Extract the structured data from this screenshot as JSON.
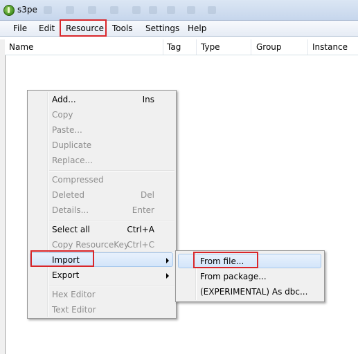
{
  "window": {
    "title": "s3pe"
  },
  "menubar": {
    "items": [
      {
        "label": "File"
      },
      {
        "label": "Edit"
      },
      {
        "label": "Resource"
      },
      {
        "label": "Tools"
      },
      {
        "label": "Settings"
      },
      {
        "label": "Help"
      }
    ],
    "highlighted": "Resource"
  },
  "list": {
    "columns": [
      "Name",
      "Tag",
      "Type",
      "Group",
      "Instance"
    ]
  },
  "context_menu": {
    "items": [
      {
        "label": "Add...",
        "shortcut": "Ins",
        "enabled": true
      },
      {
        "label": "Copy",
        "shortcut": "",
        "enabled": false
      },
      {
        "label": "Paste...",
        "shortcut": "",
        "enabled": false
      },
      {
        "label": "Duplicate",
        "shortcut": "",
        "enabled": false
      },
      {
        "label": "Replace...",
        "shortcut": "",
        "enabled": false
      },
      {
        "label": "Compressed",
        "shortcut": "",
        "enabled": false
      },
      {
        "label": "Deleted",
        "shortcut": "Del",
        "enabled": false
      },
      {
        "label": "Details...",
        "shortcut": "Enter",
        "enabled": false
      },
      {
        "label": "Select all",
        "shortcut": "Ctrl+A",
        "enabled": true
      },
      {
        "label": "Copy ResourceKey",
        "shortcut": "Ctrl+C",
        "enabled": false
      },
      {
        "label": "Import",
        "shortcut": "",
        "enabled": true,
        "submenu": true,
        "hovered": true
      },
      {
        "label": "Export",
        "shortcut": "",
        "enabled": true,
        "submenu": true
      },
      {
        "label": "Hex Editor",
        "shortcut": "",
        "enabled": false
      },
      {
        "label": "Text Editor",
        "shortcut": "",
        "enabled": false
      }
    ]
  },
  "import_submenu": {
    "items": [
      {
        "label": "From file...",
        "hovered": true
      },
      {
        "label": "From package..."
      },
      {
        "label": "(EXPERIMENTAL) As dbc..."
      }
    ]
  },
  "colors": {
    "highlight_box": "#d9262a",
    "hover_fill": "#d3e5fa",
    "disabled_text": "#8d8d8d"
  }
}
